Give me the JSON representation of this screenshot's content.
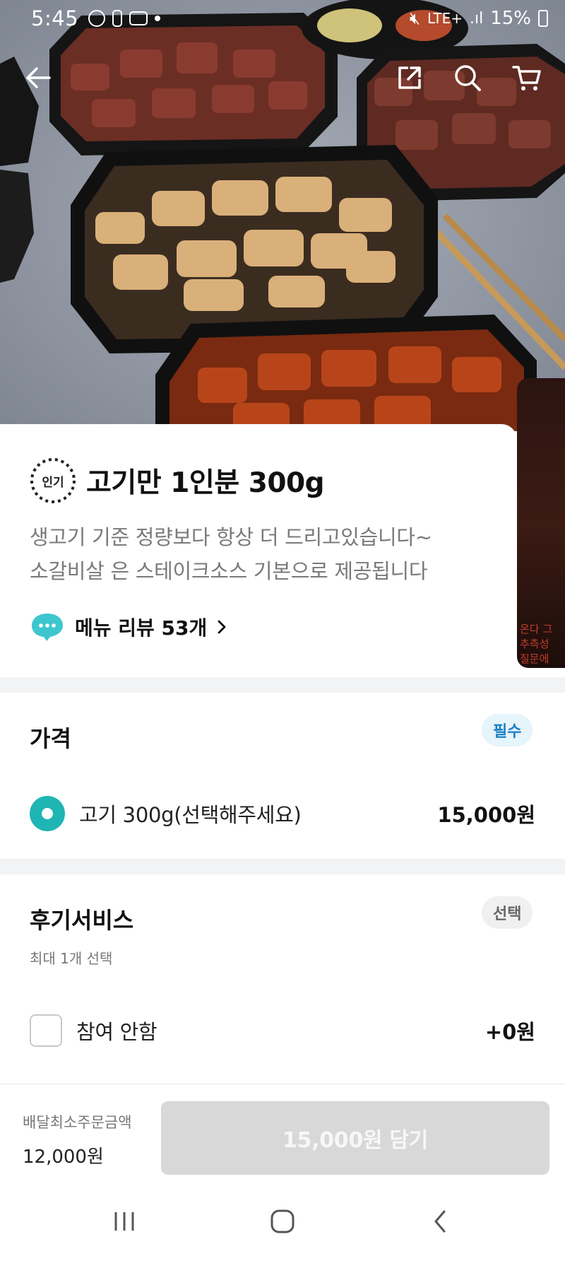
{
  "status_bar": {
    "time": "5:45",
    "network": "LTE+",
    "battery": "15%"
  },
  "hero": {
    "image_alt": "Grilled pork and beef cubes in black takeout containers"
  },
  "side_preview": {
    "text": "온다 그\n추측성 \n질문에 "
  },
  "product": {
    "badge": "인기",
    "title": "고기만 1인분 300g",
    "description_lines": [
      "생고기 기준 정량보다 항상 더 드리고있습니다~",
      "소갈비살 은 스테이크소스 기본으로 제공됩니다"
    ],
    "review_label": "메뉴 리뷰 53개"
  },
  "price_section": {
    "title": "가격",
    "tag": "필수",
    "option": {
      "label": "고기 300g(선택해주세요)",
      "price": "15,000원",
      "selected": true
    }
  },
  "review_service": {
    "title": "후기서비스",
    "tag": "선택",
    "note": "최대 1개 선택",
    "option": {
      "label": "참여 안함",
      "price": "+0원",
      "checked": false
    }
  },
  "bottom_bar": {
    "min_order_label": "배달최소주문금액",
    "min_order_value": "12,000원",
    "cart_button": "15,000원 담기"
  },
  "colors": {
    "accent": "#1fb5b4",
    "required_tag_bg": "#e6f4fb",
    "required_tag_text": "#1b7fc4",
    "disabled_button": "#d8d8d8"
  }
}
